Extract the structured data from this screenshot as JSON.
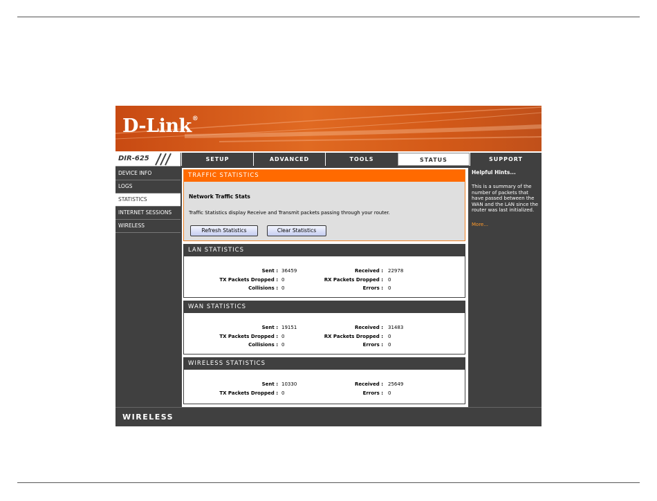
{
  "brand": {
    "logo": "D-Link",
    "reg_mark": "®",
    "model": "DIR-625"
  },
  "tabs": [
    {
      "label": "SETUP"
    },
    {
      "label": "ADVANCED"
    },
    {
      "label": "TOOLS"
    },
    {
      "label": "STATUS"
    },
    {
      "label": "SUPPORT"
    }
  ],
  "sidebar": {
    "items": [
      {
        "label": "DEVICE INFO"
      },
      {
        "label": "LOGS"
      },
      {
        "label": "STATISTICS"
      },
      {
        "label": "INTERNET SESSIONS"
      },
      {
        "label": "WIRELESS"
      }
    ]
  },
  "traffic": {
    "title": "TRAFFIC STATISTICS",
    "subtitle": "Network Traffic Stats",
    "description": "Traffic Statistics display Receive and Transmit packets passing through your router.",
    "refresh_label": "Refresh Statistics",
    "clear_label": "Clear Statistics"
  },
  "lan": {
    "title": "LAN STATISTICS",
    "sent_label": "Sent :",
    "sent": "36459",
    "received_label": "Received :",
    "received": "22978",
    "tx_label": "TX Packets Dropped :",
    "tx": "0",
    "rx_label": "RX Packets Dropped :",
    "rx": "0",
    "collisions_label": "Collisions :",
    "collisions": "0",
    "errors_label": "Errors :",
    "errors": "0"
  },
  "wan": {
    "title": "WAN STATISTICS",
    "sent_label": "Sent :",
    "sent": "19151",
    "received_label": "Received :",
    "received": "31483",
    "tx_label": "TX Packets Dropped :",
    "tx": "0",
    "rx_label": "RX Packets Dropped :",
    "rx": "0",
    "collisions_label": "Collisions :",
    "collisions": "0",
    "errors_label": "Errors :",
    "errors": "0"
  },
  "wireless": {
    "title": "WIRELESS STATISTICS",
    "sent_label": "Sent :",
    "sent": "10330",
    "received_label": "Received :",
    "received": "25649",
    "tx_label": "TX Packets Dropped :",
    "tx": "0",
    "errors_label": "Errors :",
    "errors": "0"
  },
  "hints": {
    "title": "Helpful Hints...",
    "text": "This is a summary of the number of packets that have passed between the WAN and the LAN since the router was last initialized.",
    "more": "More..."
  },
  "footer": {
    "label": "WIRELESS"
  },
  "colors": {
    "orange": "#ff6a00",
    "dark": "#404040",
    "hint_link": "#ff9a2a"
  }
}
